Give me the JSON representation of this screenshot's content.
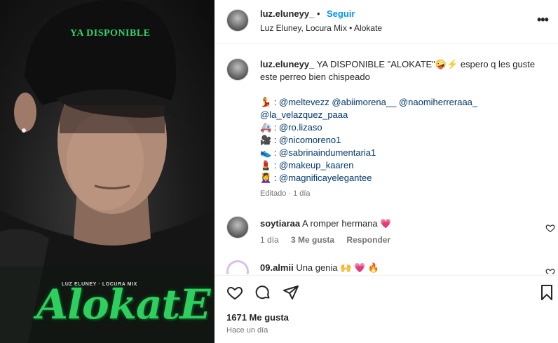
{
  "media": {
    "cap_text": "YA DISPONIBLE",
    "credits": "LUZ ELUNEY · LOCURA MIX",
    "title": "AlokatE"
  },
  "header": {
    "username": "luz.eluneyy_",
    "dot": "•",
    "follow_label": "Seguir",
    "subtitle": "Luz Eluney, Locura Mix • Alokate",
    "more": "•••"
  },
  "caption": {
    "username": "luz.eluneyy_",
    "text1": " YA DISPONIBLE \"ALOKATE\"🤪⚡ espero q les guste",
    "text2": "este perreo bien chispeado",
    "credits": [
      {
        "emoji": "💃",
        "sep": " : ",
        "mentions": "@meltevezz @abiimorena__ @naomiherreraaa_"
      },
      {
        "emoji": "",
        "sep": "",
        "mentions": "@la_velazquez_paaa"
      },
      {
        "emoji": "🚑",
        "sep": " : ",
        "mentions": "@ro.lizaso"
      },
      {
        "emoji": "🎥",
        "sep": " : ",
        "mentions": "@nicomoreno1"
      },
      {
        "emoji": "👟",
        "sep": " : ",
        "mentions": "@sabrinaindumentaria1"
      },
      {
        "emoji": "💄",
        "sep": " : ",
        "mentions": "@makeup_kaaren"
      },
      {
        "emoji": "💆‍♀️",
        "sep": " : ",
        "mentions": "@magnificayelegantee"
      }
    ],
    "meta": "Editado · 1 día"
  },
  "comments": [
    {
      "username": "soytiaraa",
      "text": " A romper hermana 💗",
      "time": "1 día",
      "likes": "3 Me gusta",
      "reply": "Responder"
    },
    {
      "username": "09.almii",
      "text": " Una genia 🙌 💗 🔥",
      "time": "",
      "likes": "",
      "reply": ""
    }
  ],
  "footer": {
    "likes": "1671 Me gusta",
    "when": "Hace un día"
  },
  "colors": {
    "accent": "#0095f6",
    "title_green": "#2ecf5e"
  }
}
